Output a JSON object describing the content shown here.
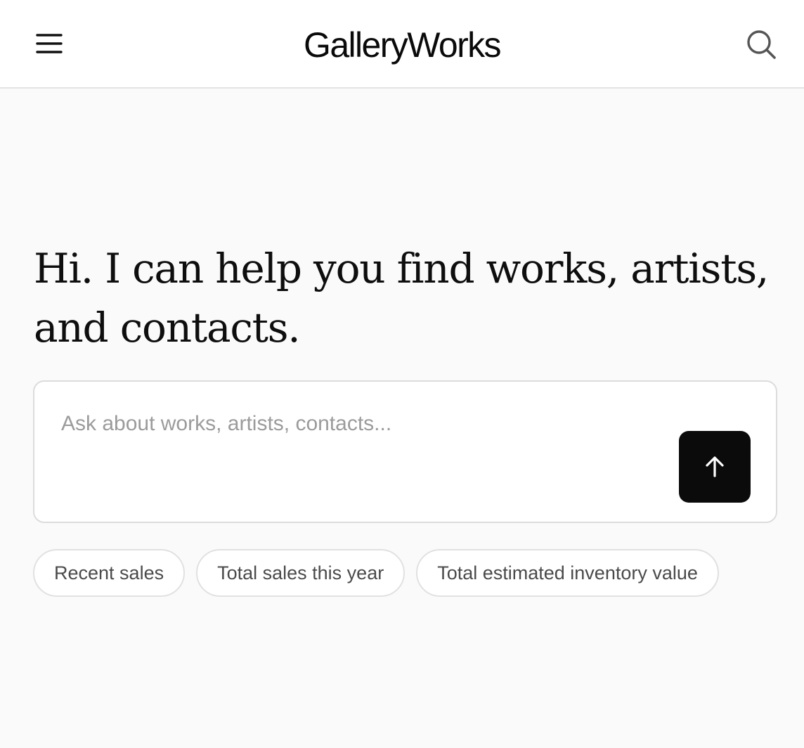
{
  "header": {
    "brand": "GalleryWorks",
    "menu_icon": "menu-icon",
    "search_icon": "search-icon"
  },
  "main": {
    "headline": "Hi. I can help you find works, artists, and contacts.",
    "composer": {
      "placeholder": "Ask about works, artists, contacts...",
      "value": "",
      "send_icon": "arrow-up-icon",
      "send_color": "#0b0b0b"
    },
    "suggestions": [
      "Recent sales",
      "Total sales this year",
      "Total estimated inventory value"
    ]
  }
}
